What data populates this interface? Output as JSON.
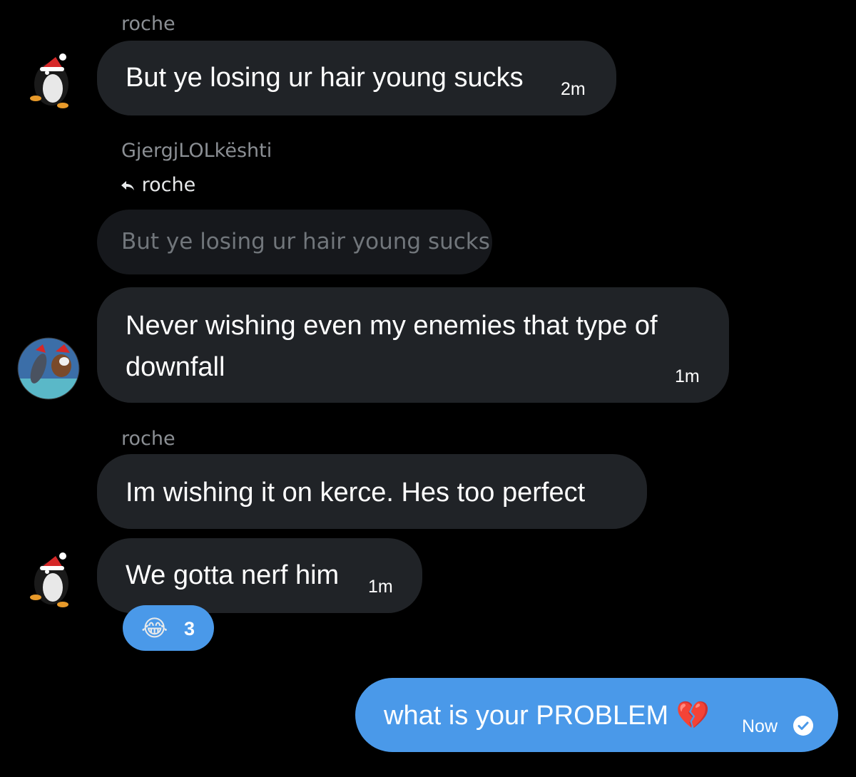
{
  "messages": [
    {
      "sender": "roche",
      "text": "But ye losing ur hair young sucks",
      "time": "2m"
    },
    {
      "sender": "GjergjLOLkështi",
      "reply_to": "roche",
      "quoted_text": "But ye losing ur hair young sucks",
      "text_line1": "Never wishing even my enemies that type of",
      "text_line2": "downfall",
      "time": "1m"
    },
    {
      "sender": "roche",
      "text": "Im wishing it on kerce. Hes too perfect"
    },
    {
      "text": "We gotta nerf him",
      "time": "1m",
      "reaction": {
        "emoji": "😂",
        "count": "3"
      }
    },
    {
      "text": "what is your PROBLEM 💔",
      "time": "Now",
      "status": "sent-check"
    }
  ],
  "colors": {
    "background": "#000000",
    "incoming_bubble": "#202327",
    "quoted_bubble": "#16181c",
    "outgoing_bubble": "#4a99e9",
    "sender_name": "#8b8f94"
  },
  "icons": {
    "reply": "reply-arrow-icon",
    "read_receipt": "check-circle-icon",
    "avatar_roche": "penguin-santa-hat-avatar",
    "avatar_gjergj": "dolphin-cow-avatar"
  }
}
